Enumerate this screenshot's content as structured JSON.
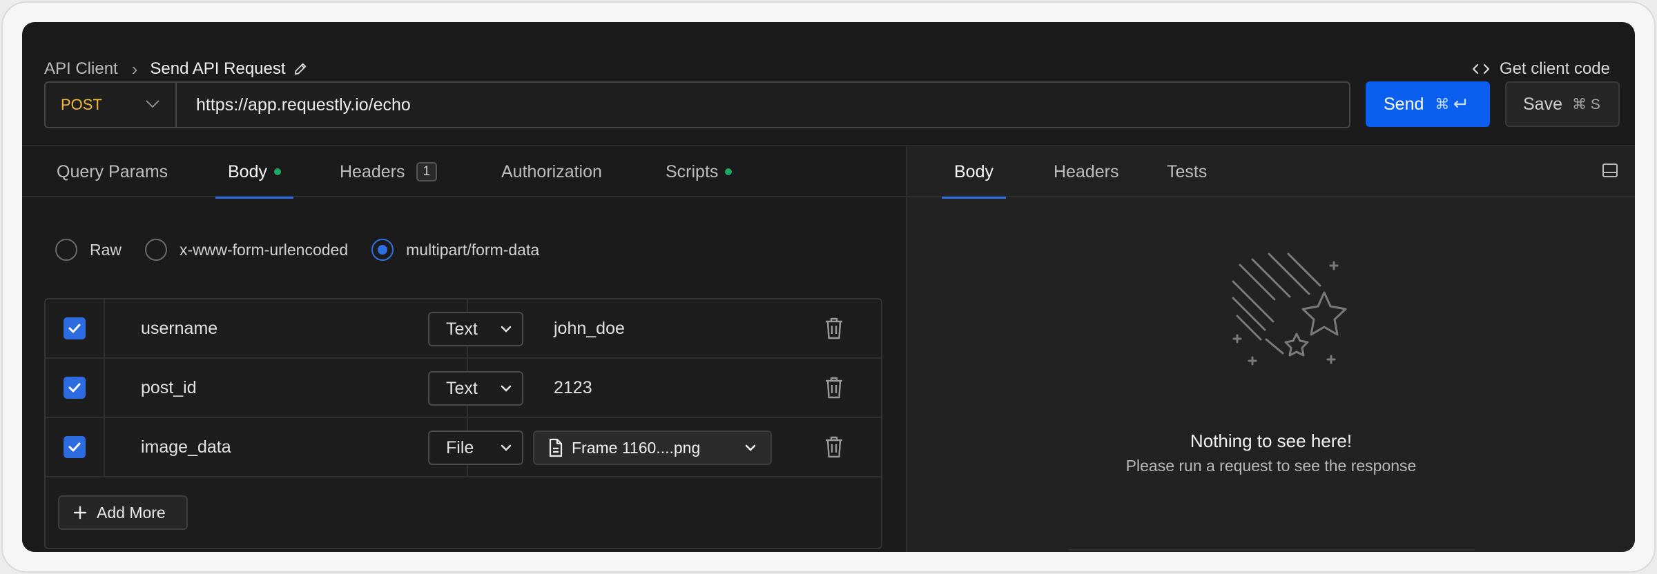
{
  "breadcrumb": {
    "root": "API Client",
    "separator": "›",
    "current": "Send API Request"
  },
  "header": {
    "client_code": "Get client code"
  },
  "request": {
    "method": "POST",
    "url": "https://app.requestly.io/echo",
    "send_label": "Send",
    "send_shortcut": "⌘",
    "save_label": "Save",
    "save_shortcut": "⌘ S"
  },
  "request_tabs": [
    {
      "label": "Query Params"
    },
    {
      "label": "Body",
      "active": true,
      "indicator": true
    },
    {
      "label": "Headers",
      "count": "1"
    },
    {
      "label": "Authorization"
    },
    {
      "label": "Scripts",
      "indicator": true
    }
  ],
  "body_types": [
    {
      "label": "Raw",
      "selected": false
    },
    {
      "label": "x-www-form-urlencoded",
      "selected": false
    },
    {
      "label": "multipart/form-data",
      "selected": true
    }
  ],
  "form_rows": [
    {
      "key": "username",
      "type": "Text",
      "value": "john_doe",
      "checked": true
    },
    {
      "key": "post_id",
      "type": "Text",
      "value": "2123",
      "checked": true
    },
    {
      "key": "image_data",
      "type": "File",
      "value": "Frame 1160....png",
      "checked": true
    }
  ],
  "add_more_label": "Add More",
  "response_tabs": [
    {
      "label": "Body",
      "active": true
    },
    {
      "label": "Headers"
    },
    {
      "label": "Tests"
    }
  ],
  "empty_state": {
    "title": "Nothing to see here!",
    "subtitle": "Please run a request to see the response"
  },
  "colors": {
    "accent": "#0a5ff1",
    "method": "#f4b93a",
    "indicator": "#1ea866",
    "background": "#1b1b1b"
  }
}
